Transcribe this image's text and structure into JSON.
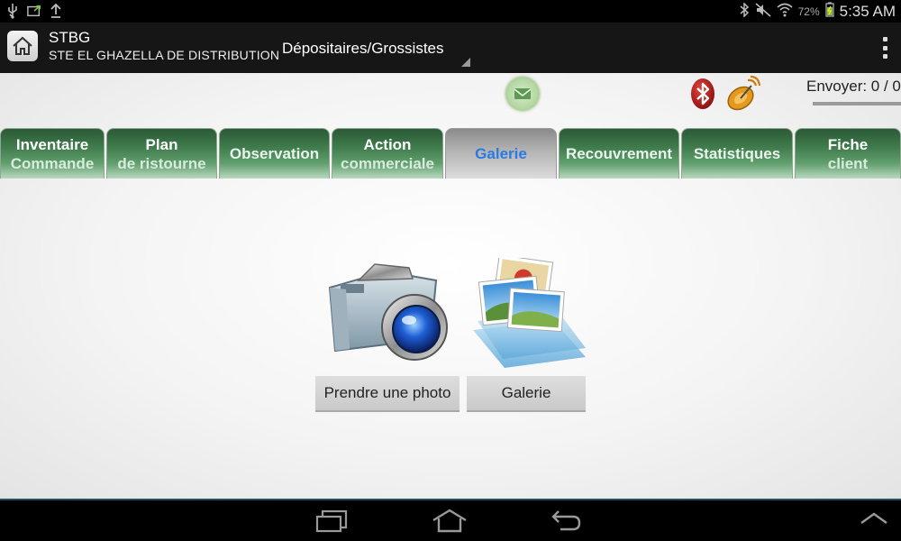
{
  "status_bar": {
    "left_icons": [
      "usb-icon",
      "screenshot-icon",
      "upload-icon"
    ],
    "right_icons": [
      "bluetooth-icon",
      "mute-icon",
      "wifi-icon",
      "battery-icon"
    ],
    "battery": "72%",
    "time": "5:35 AM"
  },
  "action_bar": {
    "title": "STBG",
    "subtitle": "STE EL GHAZELLA DE DISTRIBUTION",
    "spinner_value": "Dépositaires/Grossistes"
  },
  "toolbar": {
    "envoyer": "Envoyer: 0 / 0"
  },
  "tabs": [
    {
      "line1": "Inventaire",
      "line2": "Commande"
    },
    {
      "line1": "Plan",
      "line2": "de ristourne"
    },
    {
      "line1": "Observation",
      "line2": ""
    },
    {
      "line1": "Action",
      "line2": "commerciale"
    },
    {
      "line1": "Galerie",
      "line2": "",
      "active": true
    },
    {
      "line1": "Recouvrement",
      "line2": ""
    },
    {
      "line1": "Statistiques",
      "line2": ""
    },
    {
      "line1": "Fiche",
      "line2": "client"
    }
  ],
  "actions": {
    "photo_label": "Prendre une photo",
    "gallery_label": "Galerie"
  },
  "colors": {
    "tab_green": "#3e7a4b",
    "active_tab_text": "#2a7ae2",
    "nav_accent": "#1e4f63"
  }
}
